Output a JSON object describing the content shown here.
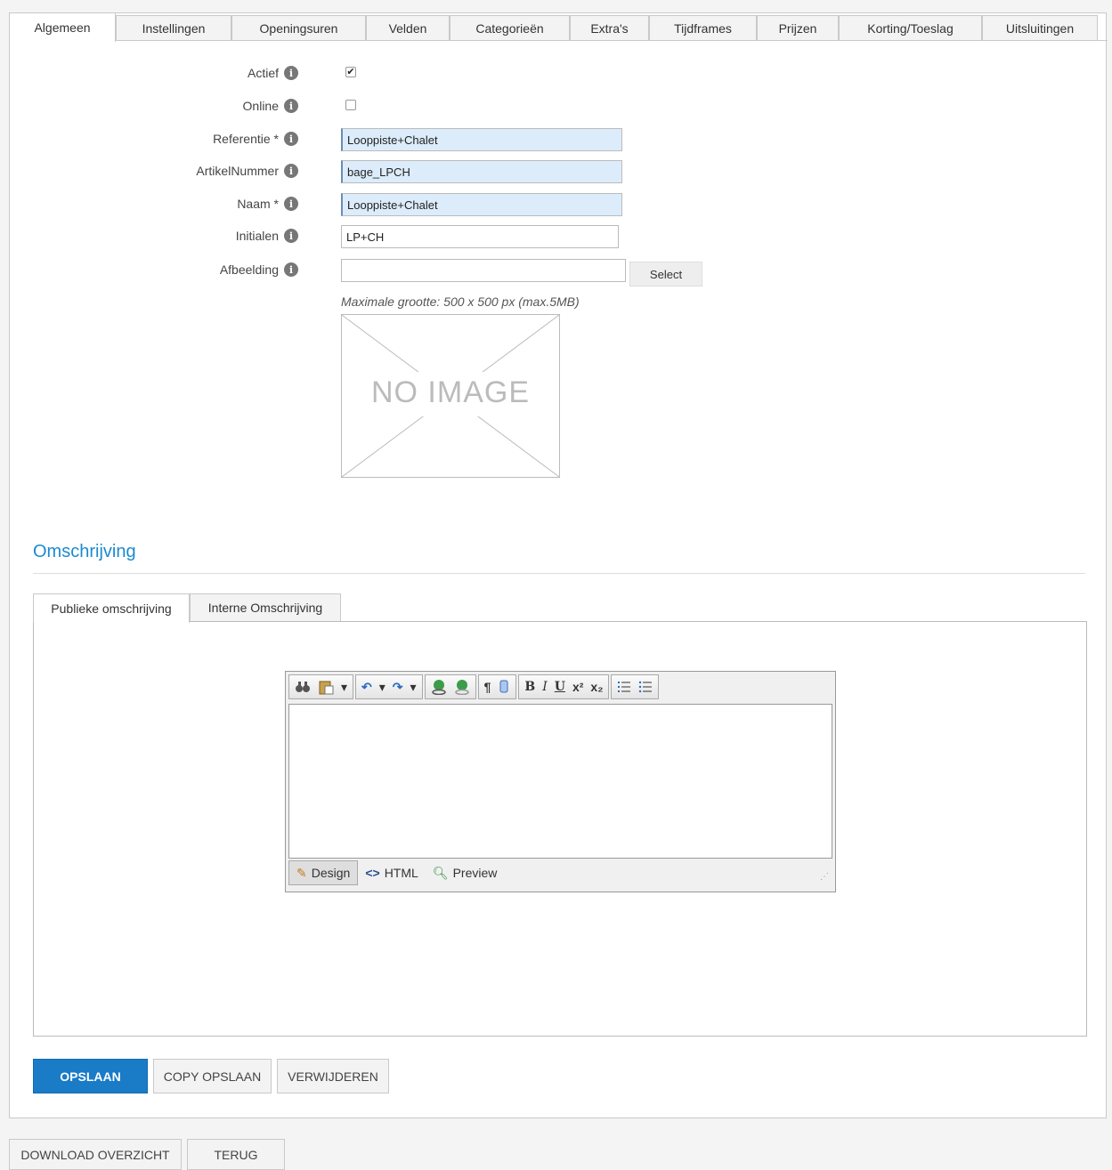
{
  "tabs": [
    {
      "label": "Algemeen",
      "active": true
    },
    {
      "label": "Instellingen"
    },
    {
      "label": "Openingsuren"
    },
    {
      "label": "Velden"
    },
    {
      "label": "Categorieën"
    },
    {
      "label": "Extra's"
    },
    {
      "label": "Tijdframes"
    },
    {
      "label": "Prijzen"
    },
    {
      "label": "Korting/Toeslag"
    },
    {
      "label": "Uitsluitingen"
    }
  ],
  "form": {
    "actief_label": "Actief",
    "actief_checked": true,
    "online_label": "Online",
    "online_checked": false,
    "referentie_label": "Referentie *",
    "referentie_value": "Looppiste+Chalet",
    "artikelnummer_label": "ArtikelNummer",
    "artikelnummer_value": "bage_LPCH",
    "naam_label": "Naam *",
    "naam_value": "Looppiste+Chalet",
    "initialen_label": "Initialen",
    "initialen_value": "LP+CH",
    "afbeelding_label": "Afbeelding",
    "afbeelding_value": "",
    "select_button": "Select",
    "max_size_hint": "Maximale grootte: 500 x 500 px (max.5MB)",
    "no_image_text": "NO IMAGE"
  },
  "description": {
    "title": "Omschrijving",
    "tabs": [
      {
        "label": "Publieke omschrijving",
        "active": true
      },
      {
        "label": "Interne Omschrijving"
      }
    ],
    "editor": {
      "modes": [
        "Design",
        "HTML",
        "Preview"
      ],
      "active_mode": "Design",
      "toolbar_text": {
        "bold": "B",
        "italic": "I",
        "underline": "U",
        "superscript": "x²",
        "subscript": "x₂"
      }
    }
  },
  "actions": {
    "save": "OPSLAAN",
    "copy_save": "COPY OPSLAAN",
    "delete": "VERWIJDEREN"
  },
  "footer": {
    "download": "DOWNLOAD OVERZICHT",
    "back": "TERUG"
  },
  "colors": {
    "accent": "#1b8ad1",
    "primary_button": "#1a7bc7",
    "required_field": "#dcecfb"
  }
}
